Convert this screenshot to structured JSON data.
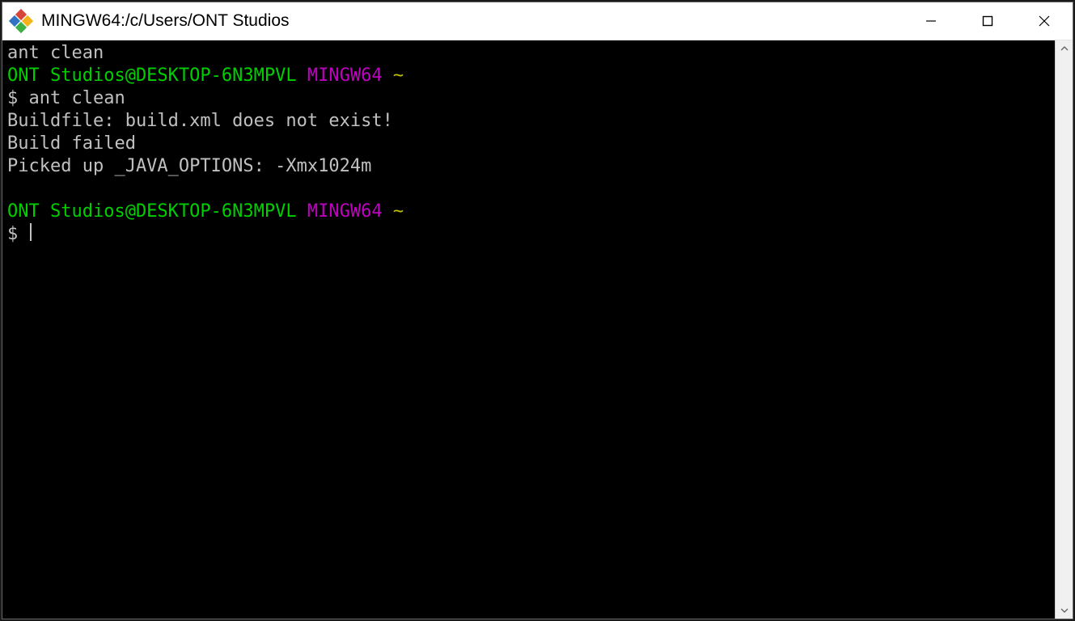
{
  "window": {
    "title": "MINGW64:/c/Users/ONT Studios"
  },
  "terminal": {
    "line1": "ant clean",
    "prompt1_user": "ONT Studios@DESKTOP-6N3MPVL",
    "prompt1_env": "MINGW64",
    "prompt1_path": "~",
    "cmd1_symbol": "$",
    "cmd1_text": "ant clean",
    "out1": "Buildfile: build.xml does not exist!",
    "out2": "Build failed",
    "out3": "Picked up _JAVA_OPTIONS: -Xmx1024m",
    "prompt2_user": "ONT Studios@DESKTOP-6N3MPVL",
    "prompt2_env": "MINGW64",
    "prompt2_path": "~",
    "cmd2_symbol": "$"
  }
}
